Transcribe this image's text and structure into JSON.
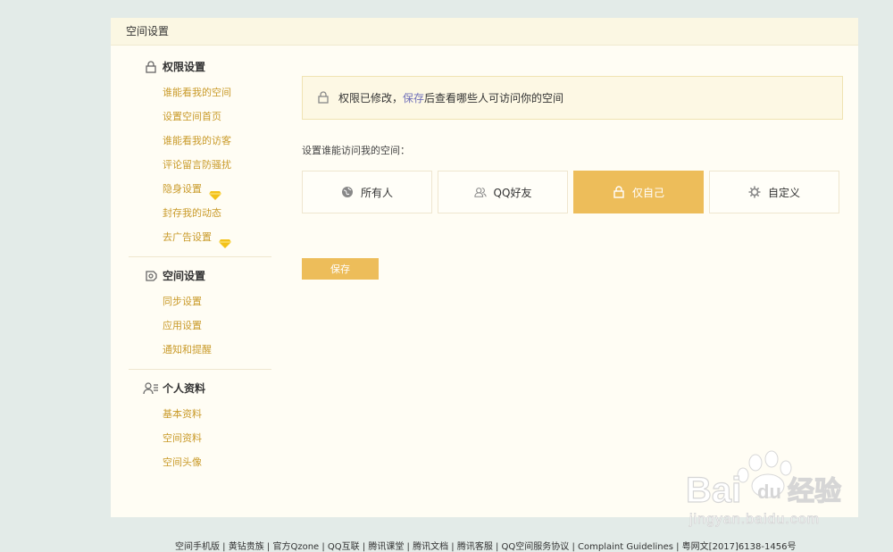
{
  "panel": {
    "title": "空间设置"
  },
  "sidebar": {
    "sections": [
      {
        "title": "权限设置",
        "icon": "lock-icon",
        "items": [
          {
            "label": "谁能看我的空间"
          },
          {
            "label": "设置空间首页"
          },
          {
            "label": "谁能看我的访客"
          },
          {
            "label": "评论留言防骚扰"
          },
          {
            "label": "隐身设置",
            "badge": "diamond-icon"
          },
          {
            "label": "封存我的动态"
          },
          {
            "label": "去广告设置",
            "badge": "diamond-icon"
          }
        ]
      },
      {
        "title": "空间设置",
        "icon": "space-icon",
        "items": [
          {
            "label": "同步设置"
          },
          {
            "label": "应用设置"
          },
          {
            "label": "通知和提醒"
          }
        ]
      },
      {
        "title": "个人资料",
        "icon": "profile-icon",
        "items": [
          {
            "label": "基本资料"
          },
          {
            "label": "空间资料"
          },
          {
            "label": "空间头像"
          }
        ]
      }
    ]
  },
  "notice": {
    "prefix": "权限已修改，",
    "link": "保存",
    "suffix": "后查看哪些人可访问你的空间"
  },
  "prompt": "设置谁能访问我的空间：",
  "options": [
    {
      "label": "所有人",
      "icon": "globe-icon",
      "selected": false
    },
    {
      "label": "QQ好友",
      "icon": "friends-icon",
      "selected": false
    },
    {
      "label": "仅自己",
      "icon": "lock-icon",
      "selected": true
    },
    {
      "label": "自定义",
      "icon": "gear-icon",
      "selected": false
    }
  ],
  "save_label": "保存",
  "footer": "空间手机版 | 黄钻贵族 | 官方Qzone | QQ互联 | 腾讯课堂 | 腾讯文档 | 腾讯客服 | QQ空间服务协议 | Complaint Guidelines | 粤网文[2017]6138-1456号",
  "watermark": {
    "brand": "Bai",
    "brand2": "du",
    "suffix": "经验",
    "url": "jingyan.baidu.com"
  },
  "colors": {
    "accent": "#edbd5a",
    "link": "#c99a29",
    "background": "#e3ebe8",
    "panel": "#fffdf4"
  }
}
